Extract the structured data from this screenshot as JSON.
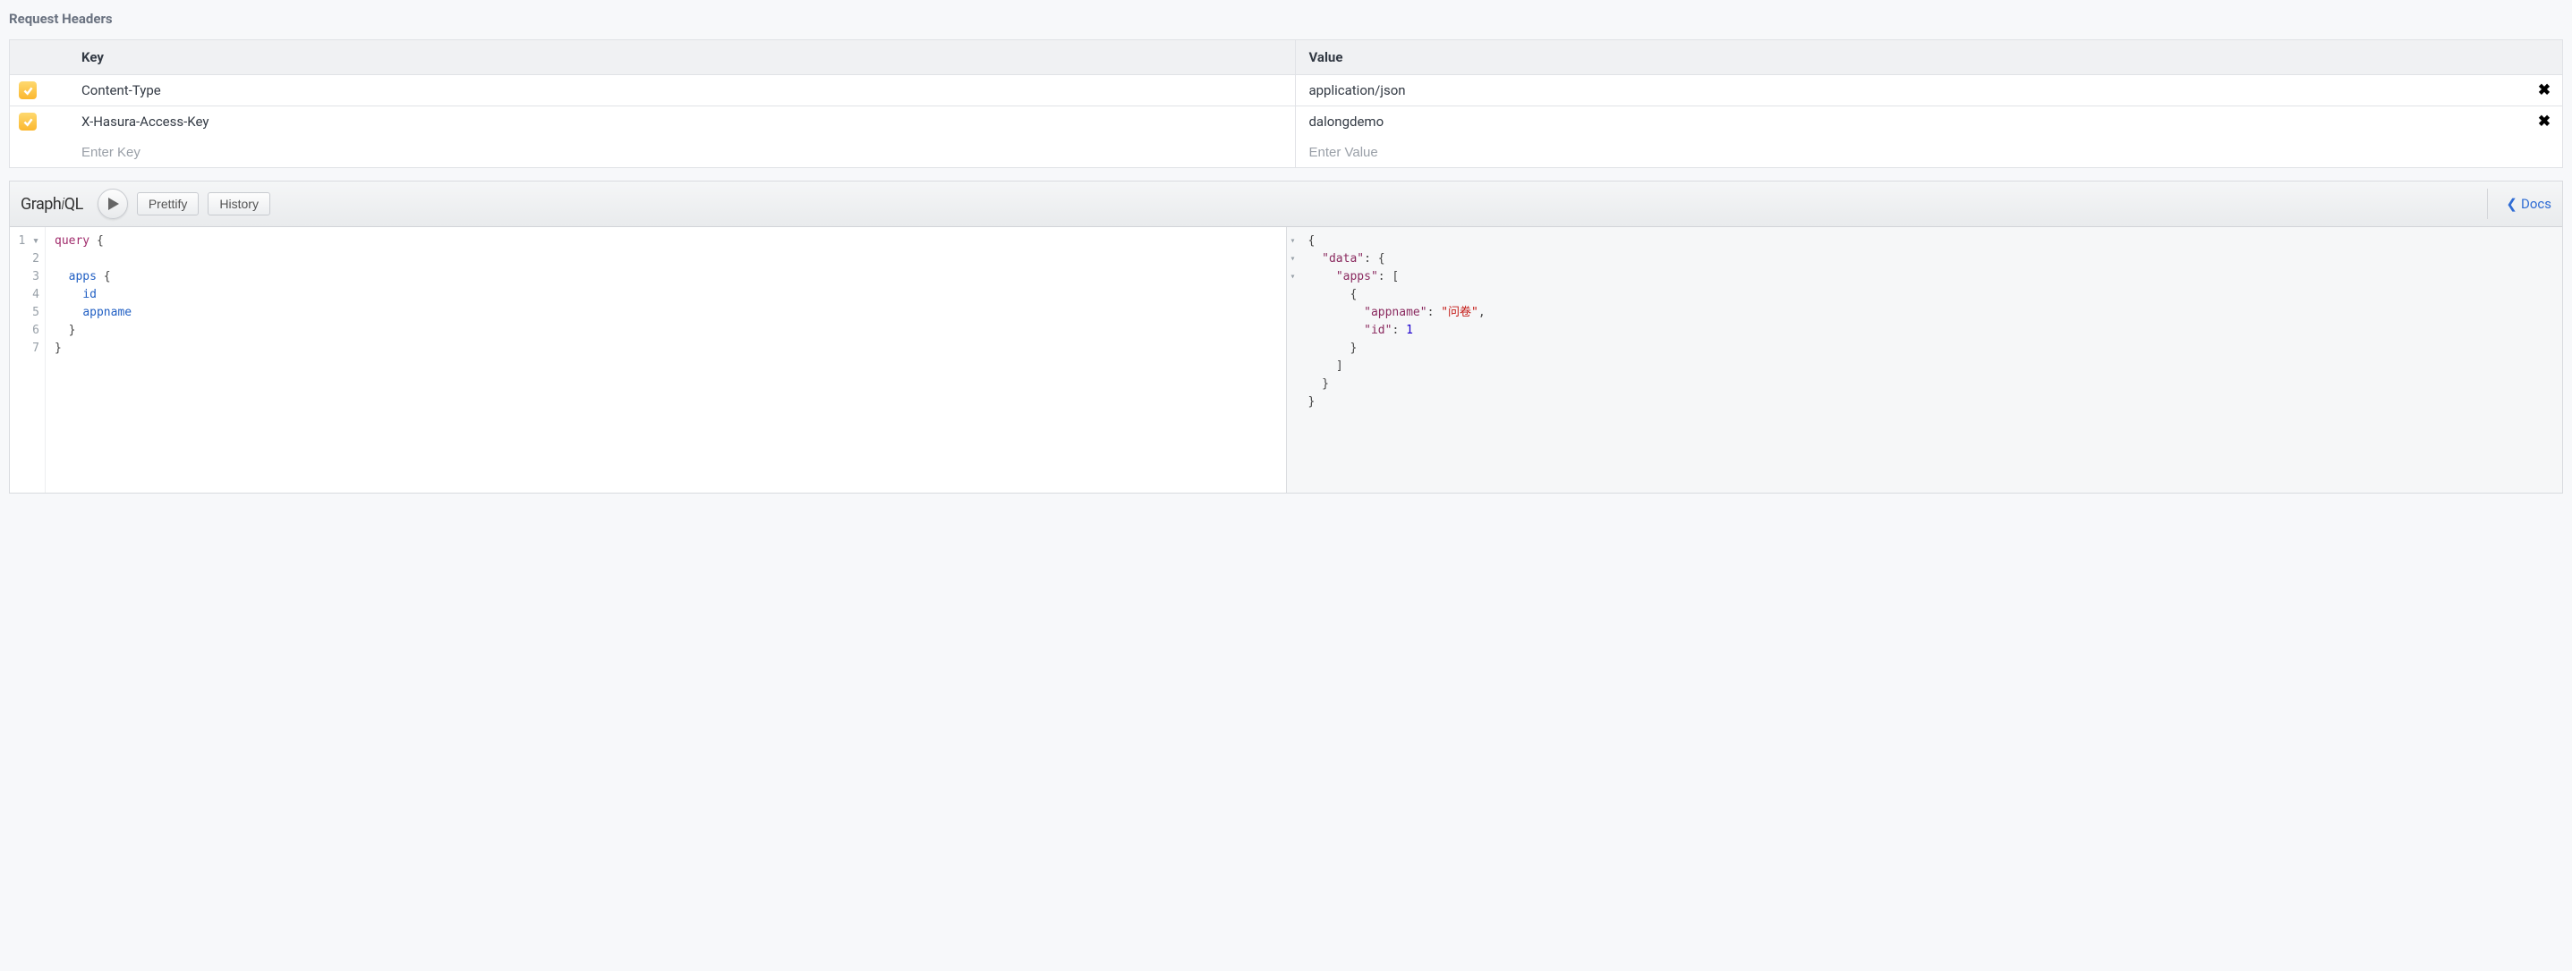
{
  "section_title": "Request Headers",
  "table": {
    "key_header": "Key",
    "value_header": "Value",
    "key_placeholder": "Enter Key",
    "value_placeholder": "Enter Value",
    "rows": [
      {
        "checked": true,
        "key": "Content-Type",
        "value": "application/json"
      },
      {
        "checked": true,
        "key": "X-Hasura-Access-Key",
        "value": "dalongdemo"
      }
    ]
  },
  "graphiql": {
    "logo_prefix": "Graph",
    "logo_i": "i",
    "logo_suffix": "QL",
    "prettify_label": "Prettify",
    "history_label": "History",
    "docs_label": "Docs",
    "query_lines": [
      {
        "n": "1",
        "fold": "▾",
        "tokens": [
          [
            "keyword",
            "query"
          ],
          [
            "text",
            " "
          ],
          [
            "brace",
            "{"
          ]
        ]
      },
      {
        "n": "2",
        "fold": "",
        "tokens": []
      },
      {
        "n": "3",
        "fold": "",
        "tokens": [
          [
            "text",
            "  "
          ],
          [
            "property",
            "apps"
          ],
          [
            "text",
            " "
          ],
          [
            "brace",
            "{"
          ]
        ]
      },
      {
        "n": "4",
        "fold": "",
        "tokens": [
          [
            "text",
            "    "
          ],
          [
            "property",
            "id"
          ]
        ]
      },
      {
        "n": "5",
        "fold": "",
        "tokens": [
          [
            "text",
            "    "
          ],
          [
            "property",
            "appname"
          ]
        ]
      },
      {
        "n": "6",
        "fold": "",
        "tokens": [
          [
            "text",
            "  "
          ],
          [
            "brace",
            "}"
          ]
        ]
      },
      {
        "n": "7",
        "fold": "",
        "tokens": [
          [
            "brace",
            "}"
          ]
        ]
      }
    ],
    "result_lines": [
      {
        "fold": "▾",
        "tokens": [
          [
            "brace",
            "{"
          ]
        ]
      },
      {
        "fold": "▾",
        "tokens": [
          [
            "text",
            "  "
          ],
          [
            "key",
            "\"data\""
          ],
          [
            "brace",
            ": {"
          ]
        ]
      },
      {
        "fold": "▾",
        "tokens": [
          [
            "text",
            "    "
          ],
          [
            "key",
            "\"apps\""
          ],
          [
            "brace",
            ": ["
          ]
        ]
      },
      {
        "fold": "",
        "tokens": [
          [
            "text",
            "      "
          ],
          [
            "brace",
            "{"
          ]
        ]
      },
      {
        "fold": "",
        "tokens": [
          [
            "text",
            "        "
          ],
          [
            "key",
            "\"appname\""
          ],
          [
            "brace",
            ": "
          ],
          [
            "str",
            "\"问卷\""
          ],
          [
            "brace",
            ","
          ]
        ]
      },
      {
        "fold": "",
        "tokens": [
          [
            "text",
            "        "
          ],
          [
            "key",
            "\"id\""
          ],
          [
            "brace",
            ": "
          ],
          [
            "num",
            "1"
          ]
        ]
      },
      {
        "fold": "",
        "tokens": [
          [
            "text",
            "      "
          ],
          [
            "brace",
            "}"
          ]
        ]
      },
      {
        "fold": "",
        "tokens": [
          [
            "text",
            "    "
          ],
          [
            "brace",
            "]"
          ]
        ]
      },
      {
        "fold": "",
        "tokens": [
          [
            "text",
            "  "
          ],
          [
            "brace",
            "}"
          ]
        ]
      },
      {
        "fold": "",
        "tokens": [
          [
            "brace",
            "}"
          ]
        ]
      }
    ]
  }
}
